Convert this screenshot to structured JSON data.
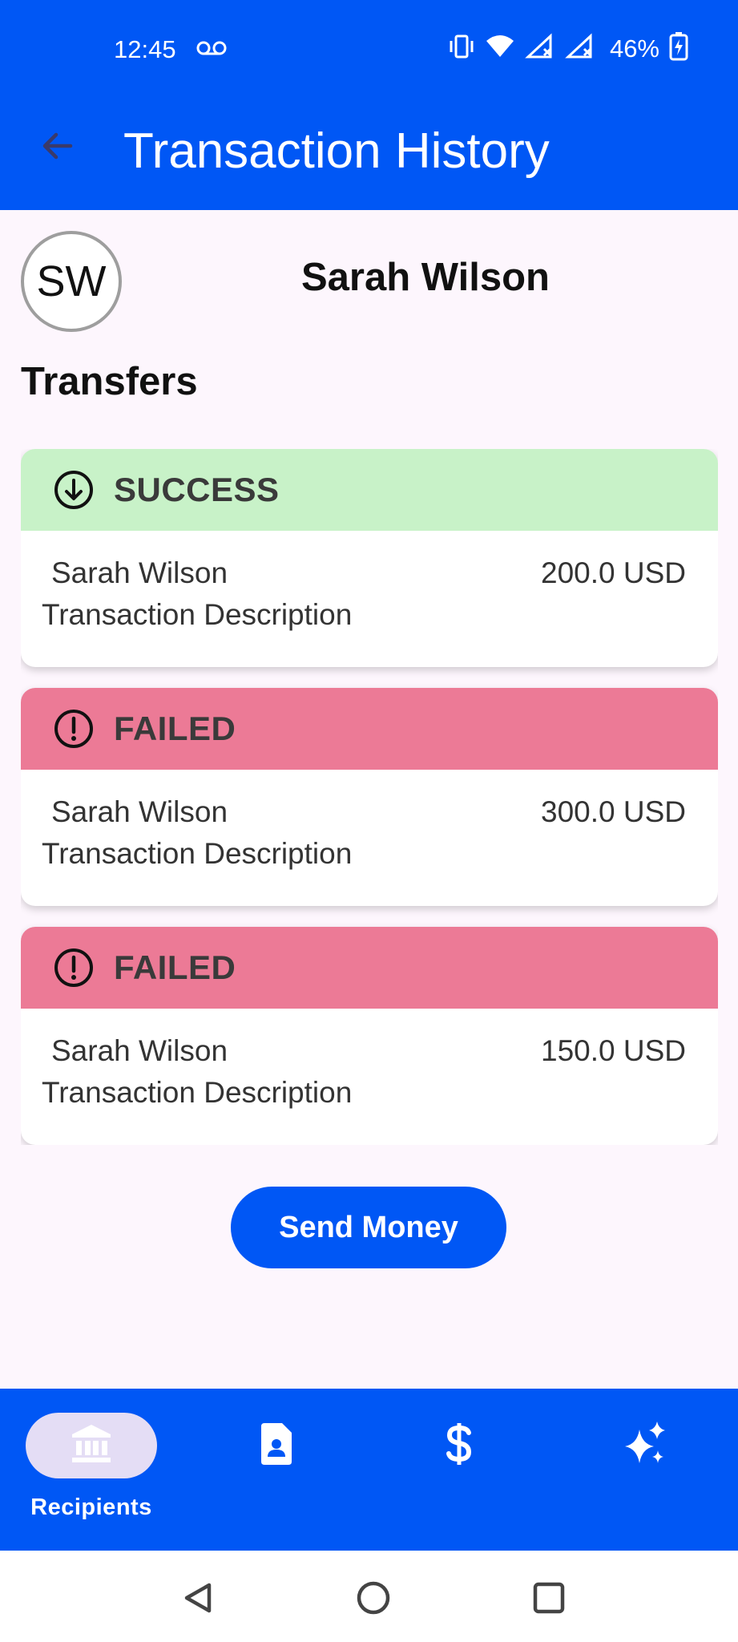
{
  "status_bar": {
    "time": "12:45",
    "battery": "46%",
    "icons": [
      "voicemail-icon",
      "vibrate-icon",
      "wifi-icon",
      "signal-icon",
      "signal-icon",
      "battery-charging-icon"
    ]
  },
  "app_bar": {
    "title": "Transaction History",
    "back_icon": "arrow-back-icon"
  },
  "profile": {
    "initials": "SW",
    "name": "Sarah Wilson"
  },
  "section_title": "Transfers",
  "transactions": [
    {
      "status": "SUCCESS",
      "status_icon": "arrow-down-circle-icon",
      "name": "Sarah Wilson",
      "amount": "200.0 USD",
      "description": "Transaction Description",
      "color": "#C8F2C8"
    },
    {
      "status": "FAILED",
      "status_icon": "exclamation-circle-icon",
      "name": "Sarah Wilson",
      "amount": "300.0 USD",
      "description": "Transaction Description",
      "color": "#EC7A96"
    },
    {
      "status": "FAILED",
      "status_icon": "exclamation-circle-icon",
      "name": "Sarah Wilson",
      "amount": "150.0 USD",
      "description": "Transaction Description",
      "color": "#EC7A96"
    }
  ],
  "send_button_label": "Send Money",
  "bottom_nav": {
    "items": [
      {
        "label": "Recipients",
        "icon": "bank-icon",
        "active": true
      },
      {
        "label": "",
        "icon": "contact-card-icon",
        "active": false
      },
      {
        "label": "",
        "icon": "dollar-icon",
        "active": false
      },
      {
        "label": "",
        "icon": "sparkle-icon",
        "active": false
      }
    ]
  },
  "system_nav": {
    "icons": [
      "nav-back-icon",
      "nav-home-icon",
      "nav-recents-icon"
    ]
  },
  "colors": {
    "primary": "#0057F5",
    "background": "#FDF6FD",
    "success": "#C8F2C8",
    "failed": "#EC7A96"
  }
}
